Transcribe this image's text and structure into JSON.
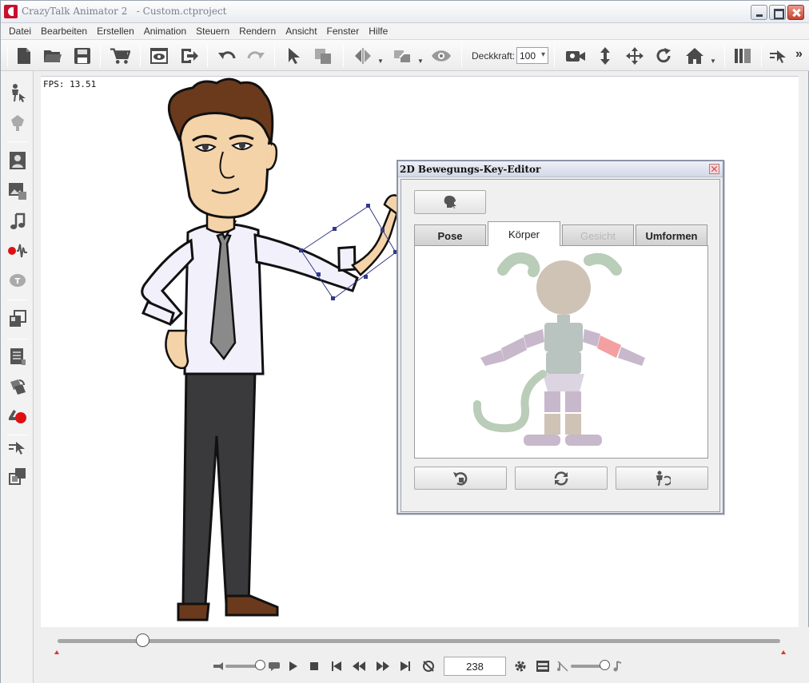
{
  "window": {
    "title": "CrazyTalk Animator 2   - Custom.ctproject"
  },
  "menu": {
    "items": [
      {
        "label": "Datei"
      },
      {
        "label": "Bearbeiten"
      },
      {
        "label": "Erstellen"
      },
      {
        "label": "Animation"
      },
      {
        "label": "Steuern"
      },
      {
        "label": "Rendern"
      },
      {
        "label": "Ansicht"
      },
      {
        "label": "Fenster"
      },
      {
        "label": "Hilfe"
      }
    ]
  },
  "toolbar": {
    "opacity_label": "Deckkraft:",
    "opacity_value": "100",
    "more": "»"
  },
  "stage": {
    "fps_text": "FPS: 13.51"
  },
  "editor": {
    "title": "2D Bewegungs-Key-Editor",
    "tabs": [
      {
        "label": "Pose",
        "state": "normal"
      },
      {
        "label": "Körper",
        "state": "active"
      },
      {
        "label": "Gesicht",
        "state": "disabled"
      },
      {
        "label": "Umformen",
        "state": "normal"
      }
    ],
    "highlighted_part": "right-lower-arm",
    "colors": {
      "head": "#cfc3b6",
      "ears": "#b9cdb8",
      "torso": "#b9c3bf",
      "arms": "#c8b8cc",
      "selected": "#f2a0a0",
      "legs": "#cfc3b6",
      "feet": "#c8b8cc"
    }
  },
  "timeline": {
    "frame": "238",
    "scrub_fraction": 0.117
  }
}
